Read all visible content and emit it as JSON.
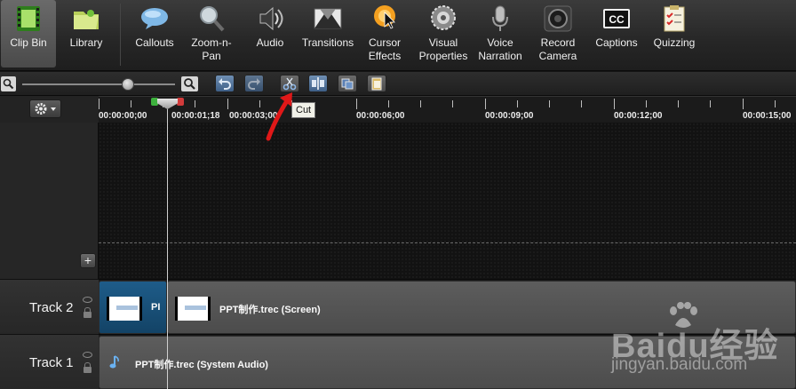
{
  "toolbar": {
    "tools": [
      {
        "label": "Clip Bin",
        "icon": "film-strip-icon",
        "active": true
      },
      {
        "label": "Library",
        "icon": "folder-icon"
      },
      {
        "label": "Callouts",
        "icon": "speech-bubble-icon"
      },
      {
        "label": "Zoom-n-\nPan",
        "icon": "magnifier-icon"
      },
      {
        "label": "Audio",
        "icon": "speaker-icon"
      },
      {
        "label": "Transitions",
        "icon": "transition-icon"
      },
      {
        "label": "Cursor\nEffects",
        "icon": "cursor-icon"
      },
      {
        "label": "Visual\nProperties",
        "icon": "gear-wheel-icon"
      },
      {
        "label": "Voice\nNarration",
        "icon": "microphone-icon"
      },
      {
        "label": "Record\nCamera",
        "icon": "camera-icon"
      },
      {
        "label": "Captions",
        "icon": "cc-icon"
      },
      {
        "label": "Quizzing",
        "icon": "checklist-icon"
      }
    ]
  },
  "subbar": {
    "zoom_level": 0.8,
    "buttons": [
      "undo-icon",
      "redo-icon",
      "cut-icon",
      "split-icon",
      "copy-icon",
      "paste-icon"
    ]
  },
  "ruler": {
    "ticks": [
      "00:00:00;00",
      "00:00:01;18",
      "00:00:03;00",
      "00:00:06;00",
      "00:00:09;00",
      "00:00:12;00",
      "00:00:15;00"
    ]
  },
  "tooltip": {
    "text": "Cut"
  },
  "tracks": [
    {
      "name": "Track 2",
      "clips": [
        {
          "label": "PI"
        },
        {
          "label": "PPT制作.trec (Screen)"
        }
      ]
    },
    {
      "name": "Track 1",
      "clips": [
        {
          "label": "PPT制作.trec (System Audio)"
        }
      ]
    }
  ],
  "colors": {
    "annotation_arrow": "#e01818",
    "selected_clip": "#1e5c89"
  },
  "watermark": {
    "logo": "Baidu经验",
    "url": "jingyan.baidu.com"
  }
}
